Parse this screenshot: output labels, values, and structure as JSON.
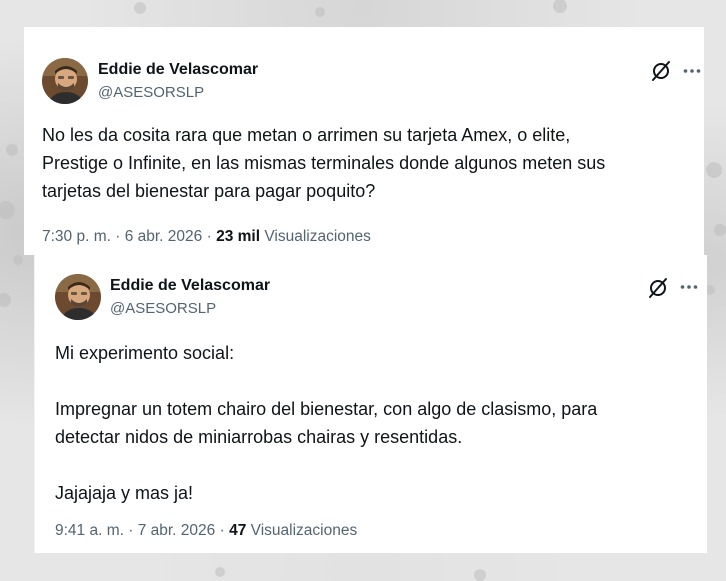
{
  "main_tweet": {
    "author_name": "Eddie de Velascomar",
    "author_handle": "@ASESORSLP",
    "text": "No les da cosita rara que metan o arrimen su tarjeta Amex, o elite,\nPrestige o Infinite, en las mismas terminales donde algunos meten sus\ntarjetas del bienestar para pagar poquito?",
    "time": "7:30 p. m. · 6 abr. 2026",
    "separator": "·",
    "views_count": "23 mil",
    "views_label": "Visualizaciones",
    "icons": [
      "avatar",
      "grok-icon",
      "more-icon"
    ]
  },
  "quoted_tweet": {
    "author_name": "Eddie de Velascomar",
    "author_handle": "@ASESORSLP",
    "text": "Mi experimento social:\n\nImpregnar un totem chairo del bienestar, con algo de clasismo, para\ndetectar nidos de miniarrobas chairas y resentidas.\n\nJajajaja y mas ja!",
    "time": "9:41 a. m. · 7 abr. 2026",
    "separator": "·",
    "views_count": "47",
    "views_label": "Visualizaciones",
    "icons": [
      "avatar",
      "grok-icon",
      "more-icon"
    ]
  },
  "colors": {
    "text_primary": "#0f1419",
    "text_secondary": "#536471",
    "card_background": "#ffffff",
    "page_background": "#e6e6e6"
  }
}
